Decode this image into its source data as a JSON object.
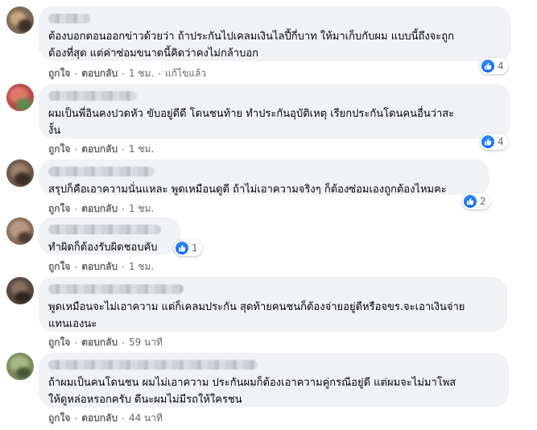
{
  "comments": [
    {
      "text": "ต้องบอกตอนออกข่าวด้วยว่า ถ้าประกันไปเคลมเงินไลปี้กี่บาท ให้มาเก็บกับผม แบบนี้ถึงจะถูก\nต้องที่สุด แต่ค่าซ่อมขนาดนี้คิดว่าคงไม่กล้าบอก",
      "like_label": "ถูกใจ",
      "reply_label": "ตอบกลับ",
      "time": "1 ชม.",
      "edited": "แก้ไขแล้ว",
      "reaction_count": "4"
    },
    {
      "text": "ผมเป็นพี่อินคงปวดหัว ขับอยู่ดีดี โดนชนท้าย ทำประกันอุบัติเหตุ เรียกประกันโดนคนอื่นว่าสะ\nงั้น",
      "like_label": "ถูกใจ",
      "reply_label": "ตอบกลับ",
      "time": "1 ชม.",
      "reaction_count": "4"
    },
    {
      "text": "สรุปก็คือเอาความนั่นแหละ พูดเหมือนดูดี ถ้าไม่เอาความจริงๆ ก็ต้องซ่อมเองถูกต้องไหมคะ",
      "like_label": "ถูกใจ",
      "reply_label": "ตอบกลับ",
      "time": "1 ชม.",
      "reaction_count": "2"
    },
    {
      "text": "ทำผิดก็ต้องรับผิดชอบคับ",
      "like_label": "ถูกใจ",
      "reply_label": "ตอบกลับ",
      "time": "1 ชม.",
      "reaction_count": "1"
    },
    {
      "text": "พูดเหมือนจะไม่เอาความ แต่ก็เคลมประกัน สุดท้ายคนชนก็ต้องจ่ายอยู่ดีหรือจขร.จะเอาเงินจ่าย\nแทนเองนะ",
      "like_label": "ถูกใจ",
      "reply_label": "ตอบกลับ",
      "time": "59 นาที"
    },
    {
      "text": "ถ้าผมเป็นคนโดนชน ผมไม่เอาความ ประกันผมก็ต้องเอาความคู่กรณีอยู่ดี แต่ผมจะไม่มาโพส\nให้ดูหล่อหรอกครับ ดีนะผมไม่มีรถให้ใครชน",
      "like_label": "ถูกใจ",
      "reply_label": "ตอบกลับ",
      "time": "44 นาที"
    }
  ],
  "separator": "·",
  "colors": {
    "bubble_bg": "#f0f2f5",
    "meta_text": "#65676b",
    "like_blue": "#0866ff"
  },
  "icons": {
    "reaction": "like-thumb-icon"
  }
}
